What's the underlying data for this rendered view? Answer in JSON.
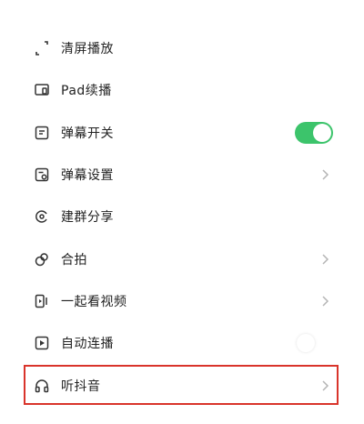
{
  "menu": {
    "items": [
      {
        "label": "清屏播放",
        "icon": "clear-screen-icon",
        "control": "none"
      },
      {
        "label": "Pad续播",
        "icon": "tablet-icon",
        "control": "none"
      },
      {
        "label": "弹幕开关",
        "icon": "danmaku-icon",
        "control": "toggle",
        "toggle_on": true
      },
      {
        "label": "弹幕设置",
        "icon": "danmaku-settings-icon",
        "control": "chevron"
      },
      {
        "label": "建群分享",
        "icon": "group-share-icon",
        "control": "none"
      },
      {
        "label": "合拍",
        "icon": "duet-icon",
        "control": "chevron"
      },
      {
        "label": "一起看视频",
        "icon": "watch-together-icon",
        "control": "chevron"
      },
      {
        "label": "自动连播",
        "icon": "autoplay-icon",
        "control": "toggle",
        "toggle_on": false
      },
      {
        "label": "听抖音",
        "icon": "headphones-icon",
        "control": "chevron",
        "highlighted": true
      }
    ]
  },
  "colors": {
    "text": "#222222",
    "icon": "#333333",
    "chevron": "#b5b5b5",
    "toggle_on": "#3cc46b",
    "highlight_border": "#d9342b"
  }
}
